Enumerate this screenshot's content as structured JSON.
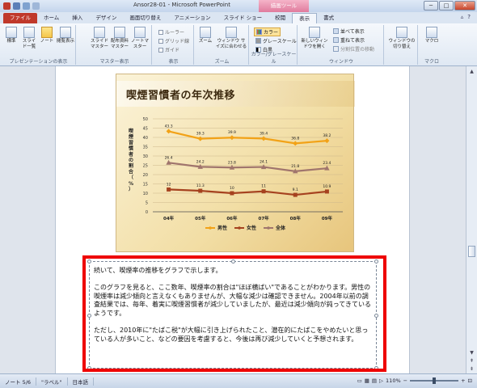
{
  "window": {
    "title": "Ansor28-01 - Microsoft PowerPoint",
    "context_tab": "描画ツール",
    "minimize": "─",
    "maximize": "□",
    "close": "✕"
  },
  "tabs": [
    "ファイル",
    "ホーム",
    "挿入",
    "デザイン",
    "画面切り替え",
    "アニメーション",
    "スライド ショー",
    "校閲",
    "表示",
    "書式"
  ],
  "ribbon": {
    "presentation_view": {
      "label": "プレゼンテーションの表示",
      "buttons": [
        "標準",
        "スライド一覧",
        "ノート",
        "閲覧表示"
      ]
    },
    "master_view": {
      "label": "マスター表示",
      "buttons": [
        "スライドマスター",
        "配布資料マスター",
        "ノートマスター"
      ]
    },
    "show": {
      "label": "表示",
      "items": [
        "ルーラー",
        "グリッド線",
        "ガイド"
      ]
    },
    "zoom": {
      "label": "ズーム",
      "buttons": [
        "ズーム",
        "ウィンドウ サイズに合わせる"
      ]
    },
    "color": {
      "label": "カラー/グレースケール",
      "items": [
        "カラー",
        "グレースケール",
        "白黒"
      ]
    },
    "window": {
      "label": "ウィンドウ",
      "buttons": [
        "新しいウィンドウを開く"
      ],
      "items": [
        "並べて表示",
        "重ねて表示",
        "分割位置の移動"
      ]
    },
    "switch": {
      "buttons": [
        "ウィンドウの切り替え"
      ]
    },
    "macro": {
      "label": "マクロ",
      "buttons": [
        "マクロ"
      ]
    }
  },
  "slide": {
    "title": "喫煙習慣者の年次推移"
  },
  "chart_data": {
    "type": "line",
    "ylabel": "喫煙習慣者の割合（%）",
    "ylim": [
      0,
      50
    ],
    "yticks": [
      0,
      5,
      10,
      15,
      20,
      25,
      30,
      35,
      40,
      45,
      50
    ],
    "categories": [
      "04年",
      "05年",
      "06年",
      "07年",
      "08年",
      "09年"
    ],
    "series": [
      {
        "name": "男性",
        "color": "#f2a217",
        "marker": "diamond",
        "values": [
          43.3,
          39.3,
          39.9,
          39.4,
          36.8,
          38.2
        ],
        "labels": [
          "43.3",
          "39.3",
          "39.9",
          "39.4",
          "36.8",
          "38.2"
        ]
      },
      {
        "name": "女性",
        "color": "#a6421f",
        "marker": "square",
        "values": [
          12,
          11.3,
          10,
          11,
          9.1,
          10.9
        ],
        "labels": [
          "12",
          "11.3",
          "10",
          "11",
          "9.1",
          "10.9"
        ]
      },
      {
        "name": "全体",
        "color": "#a0756d",
        "marker": "triangle",
        "values": [
          26.4,
          24.2,
          23.8,
          24.1,
          21.8,
          23.4
        ],
        "labels": [
          "26.4",
          "24.2",
          "23.8",
          "24.1",
          "21.8",
          "23.4"
        ]
      }
    ],
    "legend": "bottom",
    "grid": true
  },
  "notes": {
    "text": "続いて、喫煙率の推移をグラフで示します。\n\nこのグラフを見ると、ここ数年、喫煙率の割合は\"ほぼ横ばい\"であることがわかります。男性の喫煙率は減少傾向と言えなくもありませんが、大幅な減少は確認できません。2004年以前の調査結果では、毎年、着実に喫煙習慣者が減少していましたが、最近は減少傾向が鈍ってきているようです。\n\nただし、2010年に\"たばこ税\"が大幅に引き上げられたこと、潜在的にたばこをやめたいと思っている人が多いこと、などの要因を考慮すると、今後は再び減少していくと予想されます。"
  },
  "status": {
    "note": "ノート 5/6",
    "theme": "\"ラベル\"",
    "lang": "日本語",
    "zoom": "110%"
  }
}
